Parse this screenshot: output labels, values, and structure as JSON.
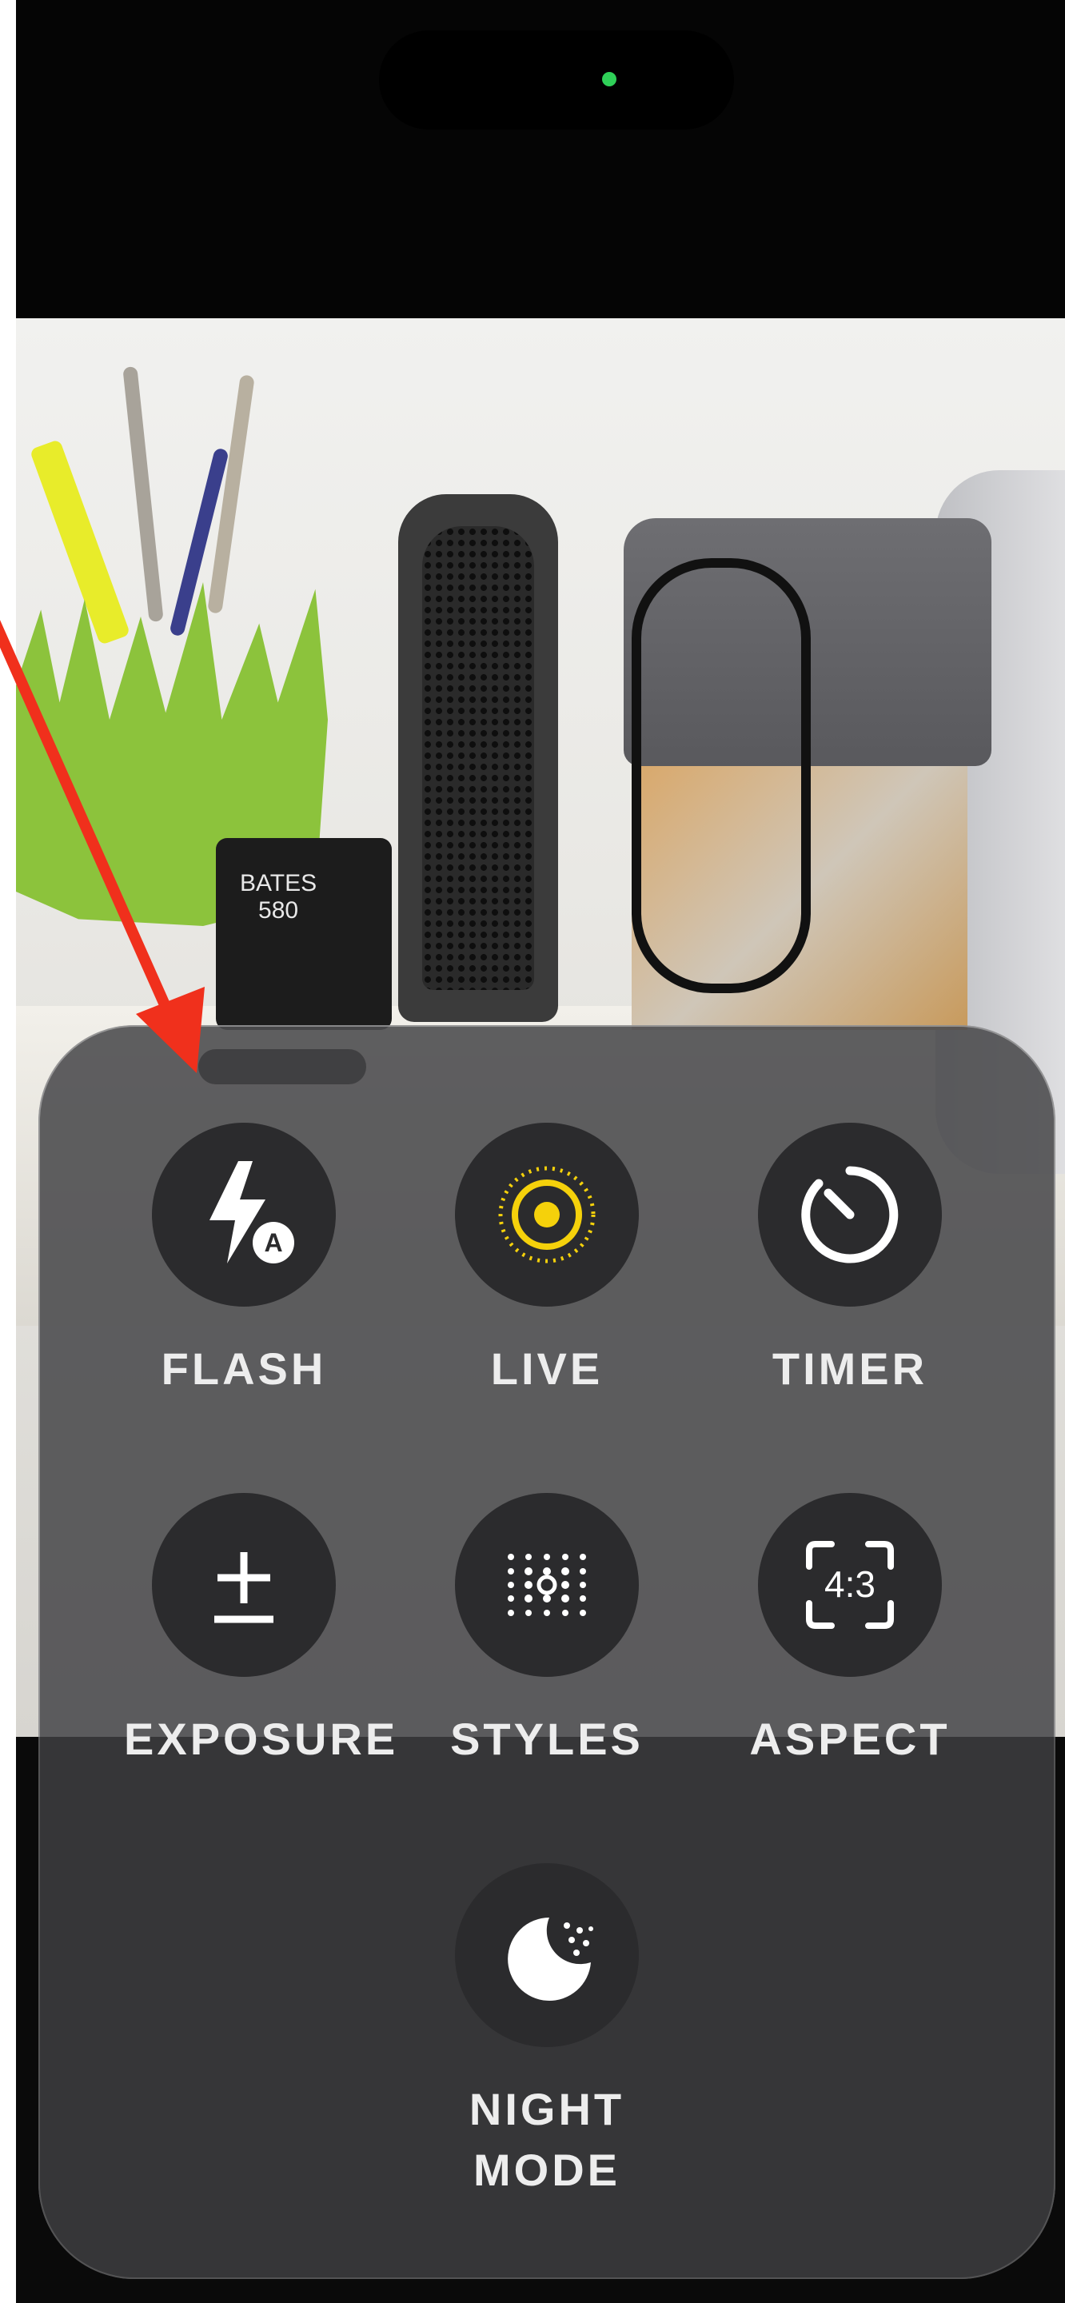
{
  "viewfinder": {
    "stapler_label": "BATES\n580"
  },
  "controls": {
    "flash": {
      "label": "FLASH",
      "icon": "flash-auto-icon",
      "color": "#ffffff"
    },
    "live": {
      "label": "LIVE",
      "icon": "live-photo-icon",
      "color": "#f5d10b"
    },
    "timer": {
      "label": "TIMER",
      "icon": "timer-icon",
      "color": "#ffffff"
    },
    "exposure": {
      "label": "EXPOSURE",
      "icon": "exposure-plus-minus-icon",
      "color": "#ffffff"
    },
    "styles": {
      "label": "STYLES",
      "icon": "photographic-styles-icon",
      "color": "#ffffff"
    },
    "aspect": {
      "label": "ASPECT",
      "icon": "aspect-ratio-icon",
      "icon_text": "4:3",
      "color": "#ffffff"
    },
    "night_mode": {
      "label": "NIGHT\nMODE",
      "icon": "night-mode-moon-icon",
      "color": "#ffffff"
    }
  },
  "colors": {
    "annotation_arrow": "#f0301c",
    "privacy_indicator": "#2fd058",
    "live_active": "#f5d10b"
  }
}
